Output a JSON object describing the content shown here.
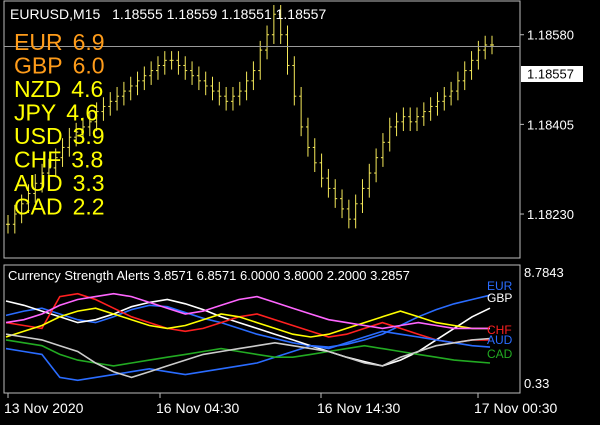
{
  "chart_window": {
    "title": "EURUSD,M15",
    "ohlc": "1.18555 1.18559 1.18551 1.18557",
    "price_scale": [
      "1.18580",
      "1.18405",
      "1.18230"
    ],
    "current_price": "1.18557",
    "bar_color": "#f5e95a"
  },
  "strength_table": [
    {
      "currency": "EUR",
      "value": "6.9",
      "color": "#ff9c1a"
    },
    {
      "currency": "GBP",
      "value": "6.0",
      "color": "#ff9c1a"
    },
    {
      "currency": "NZD",
      "value": "4.6",
      "color": "#ffff00"
    },
    {
      "currency": "JPY",
      "value": "4.6",
      "color": "#ffff00"
    },
    {
      "currency": "USD",
      "value": "3.9",
      "color": "#ffff00"
    },
    {
      "currency": "CHF",
      "value": "3.8",
      "color": "#ffff00"
    },
    {
      "currency": "AUD",
      "value": "3.3",
      "color": "#ffff00"
    },
    {
      "currency": "CAD",
      "value": "2.2",
      "color": "#ffff00"
    }
  ],
  "indicator": {
    "label": "Currency Strength Alerts 3.8571 6.8571 6.0000 3.8000 2.2000 3.2857",
    "scale_max": "8.7843",
    "scale_min": "0.33",
    "line_labels": [
      {
        "text": "EUR",
        "color": "#2a6cff"
      },
      {
        "text": "GBP",
        "color": "#ffffff"
      },
      {
        "text": "CHF",
        "color": "#ff2020"
      },
      {
        "text": "AUD",
        "color": "#2a6cff"
      },
      {
        "text": "CAD",
        "color": "#22aa22"
      }
    ]
  },
  "time_axis": [
    "13 Nov 2020",
    "16 Nov 04:30",
    "16 Nov 14:30",
    "17 Nov 00:30"
  ],
  "chart_data": [
    {
      "type": "bar",
      "title": "EURUSD,M15",
      "ylim": [
        1.1815,
        1.1864
      ],
      "y_ticks": [
        1.1858,
        1.18405,
        1.1823
      ],
      "current": 1.18557,
      "closes": [
        1.1821,
        1.1823,
        1.1825,
        1.1827,
        1.1829,
        1.1831,
        1.1832,
        1.1834,
        1.1836,
        1.1838,
        1.1839,
        1.184,
        1.1841,
        1.1843,
        1.1844,
        1.1845,
        1.1846,
        1.1847,
        1.1848,
        1.1849,
        1.185,
        1.1851,
        1.1852,
        1.1853,
        1.1853,
        1.1852,
        1.1851,
        1.185,
        1.1849,
        1.1848,
        1.1847,
        1.1846,
        1.1845,
        1.1846,
        1.1847,
        1.1849,
        1.1851,
        1.1855,
        1.1858,
        1.1862,
        1.1858,
        1.1852,
        1.1846,
        1.184,
        1.1836,
        1.1833,
        1.183,
        1.1828,
        1.1826,
        1.1824,
        1.1822,
        1.1825,
        1.1828,
        1.1831,
        1.1834,
        1.1837,
        1.184,
        1.1841,
        1.1842,
        1.1841,
        1.1842,
        1.1843,
        1.1844,
        1.1845,
        1.1846,
        1.1847,
        1.1849,
        1.1851,
        1.1853,
        1.1855,
        1.1856,
        1.1856
      ]
    },
    {
      "type": "line",
      "title": "Currency Strength Alerts",
      "ylim": [
        0.33,
        8.7843
      ],
      "series": [
        {
          "name": "EUR",
          "color": "#2a6cff",
          "values": [
            5.5,
            5.8,
            6.0,
            5.6,
            5.2,
            5.0,
            5.4,
            5.9,
            6.2,
            6.1,
            5.7,
            5.3,
            5.0,
            4.6,
            4.2,
            3.9,
            3.6,
            3.4,
            3.3,
            3.5,
            3.8,
            4.2,
            4.8,
            5.4,
            5.9,
            6.3,
            6.6,
            6.9
          ]
        },
        {
          "name": "GBP",
          "color": "#ffffff",
          "values": [
            6.5,
            6.2,
            5.8,
            5.4,
            5.0,
            5.2,
            5.6,
            6.1,
            6.4,
            6.6,
            6.3,
            5.9,
            5.4,
            5.0,
            4.6,
            4.2,
            3.8,
            3.4,
            3.0,
            2.6,
            2.3,
            2.0,
            2.4,
            3.0,
            3.8,
            4.6,
            5.4,
            6.0
          ]
        },
        {
          "name": "CHF",
          "color": "#ff2020",
          "values": [
            5.0,
            4.8,
            4.6,
            6.8,
            7.0,
            6.6,
            6.0,
            5.4,
            5.0,
            4.6,
            4.4,
            4.6,
            5.0,
            5.4,
            5.6,
            5.2,
            4.8,
            4.4,
            4.0,
            4.2,
            4.6,
            5.0,
            4.6,
            4.2,
            3.8,
            3.6,
            3.8,
            3.8
          ]
        },
        {
          "name": "AUD",
          "color": "#2a6cff",
          "values": [
            3.2,
            3.0,
            2.8,
            1.2,
            1.0,
            1.2,
            1.4,
            1.6,
            1.8,
            1.6,
            1.4,
            1.6,
            1.8,
            2.0,
            2.2,
            2.6,
            3.0,
            3.4,
            3.2,
            3.6,
            4.0,
            4.4,
            4.2,
            4.0,
            3.8,
            3.6,
            3.4,
            3.3
          ]
        },
        {
          "name": "CAD",
          "color": "#22aa22",
          "values": [
            3.8,
            3.6,
            3.4,
            2.8,
            2.4,
            2.2,
            2.0,
            2.2,
            2.4,
            2.6,
            2.8,
            3.0,
            3.2,
            3.0,
            2.8,
            2.6,
            2.6,
            2.8,
            3.0,
            3.2,
            3.4,
            3.2,
            3.0,
            2.8,
            2.6,
            2.4,
            2.3,
            2.2
          ]
        },
        {
          "name": "NZD",
          "color": "#ffff00",
          "values": [
            4.0,
            4.4,
            4.8,
            5.4,
            5.8,
            6.0,
            5.6,
            5.2,
            4.8,
            4.6,
            4.8,
            5.2,
            5.6,
            5.4,
            5.0,
            4.6,
            4.2,
            4.0,
            4.2,
            4.6,
            5.0,
            5.4,
            5.8,
            5.4,
            5.0,
            4.8,
            4.6,
            4.6
          ]
        },
        {
          "name": "JPY",
          "color": "#ff66ff",
          "values": [
            5.0,
            5.2,
            5.6,
            6.2,
            6.6,
            6.8,
            7.0,
            6.8,
            6.4,
            6.0,
            5.6,
            5.8,
            6.2,
            6.6,
            6.8,
            6.4,
            6.0,
            5.6,
            5.2,
            5.0,
            4.8,
            4.6,
            4.8,
            5.0,
            4.8,
            4.6,
            4.6,
            4.6
          ]
        },
        {
          "name": "USD",
          "color": "#cccccc",
          "values": [
            4.2,
            4.0,
            3.8,
            3.4,
            3.0,
            2.2,
            1.6,
            1.2,
            1.6,
            2.0,
            2.4,
            2.8,
            3.0,
            3.2,
            3.4,
            3.6,
            3.4,
            3.2,
            3.0,
            2.6,
            2.2,
            2.0,
            2.6,
            3.0,
            3.4,
            3.6,
            3.8,
            3.9
          ]
        }
      ]
    }
  ]
}
